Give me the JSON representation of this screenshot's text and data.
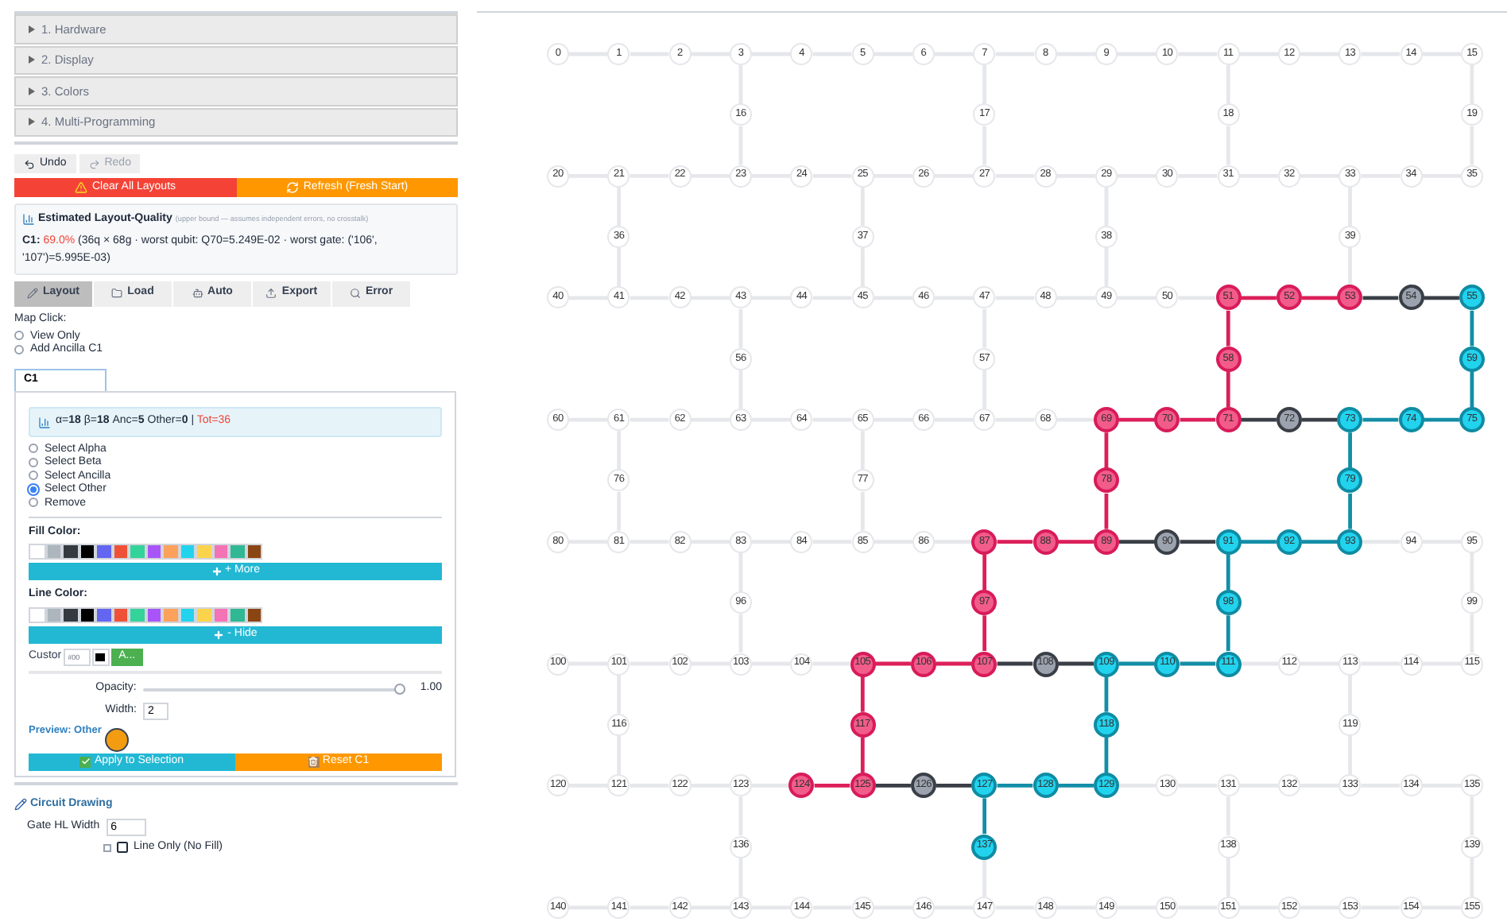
{
  "accordion": [
    {
      "label": "1. Hardware",
      "expanded": false
    },
    {
      "label": "2. Display",
      "expanded": false
    },
    {
      "label": "3. Colors",
      "expanded": false
    },
    {
      "label": "4. Multi-Programming",
      "expanded": false
    }
  ],
  "history_buttons": [
    {
      "label": "Undo",
      "kind": "undo",
      "disabled": false
    },
    {
      "label": "Redo",
      "kind": "redo",
      "disabled": true
    }
  ],
  "actions": [
    {
      "label": "Clear All Layouts",
      "kind": "danger"
    },
    {
      "label": "Refresh (Fresh Start)",
      "kind": "refresh"
    }
  ],
  "quality": {
    "title": "Estimated Layout-Quality",
    "note": "(upper bound — assumes independent errors, no crosstalk)",
    "circuit": "C1:",
    "score": "69.0%",
    "detail": "(36q × 68g · worst qubit: Q70=5.249E-02 · worst gate: ('106', '107')=5.995E-03)"
  },
  "mode_tabs": [
    {
      "label": "Layout",
      "kind": "layout",
      "selected": true
    },
    {
      "label": "Load",
      "kind": "load",
      "selected": false
    },
    {
      "label": "Auto",
      "kind": "auto",
      "selected": false
    },
    {
      "label": "Export",
      "kind": "export",
      "selected": false
    },
    {
      "label": "Error",
      "kind": "error",
      "selected": false
    }
  ],
  "map_click": {
    "label": "Map Click:",
    "options": [
      {
        "label": "View Only",
        "selected": false
      },
      {
        "label": "Add Ancilla C1",
        "selected": false
      }
    ]
  },
  "circuit_tabs": [
    {
      "label": "C1",
      "selected": true
    }
  ],
  "stats": {
    "summary": "α=**18** β=**18** Anc=**5** Other=**0** |",
    "total": "Tot=36"
  },
  "select_modes": [
    {
      "label": "Select Alpha",
      "selected": false
    },
    {
      "label": "Select Beta",
      "selected": false
    },
    {
      "label": "Select Ancilla",
      "selected": false
    },
    {
      "label": "Select Other",
      "selected": true
    },
    {
      "label": "Remove",
      "selected": false
    }
  ],
  "fill_color": {
    "label": "Fill Color:",
    "button": "+ More",
    "swatches": [
      {
        "color": "#ffffff"
      },
      {
        "color": "#adb5bd"
      },
      {
        "color": "#343a40"
      },
      {
        "color": "#000000"
      },
      {
        "color": "#6366f1"
      },
      {
        "color": "#ef5137"
      },
      {
        "color": "#34d399"
      },
      {
        "color": "#a855f7"
      },
      {
        "color": "#fba15b"
      },
      {
        "color": "#22d3ee"
      },
      {
        "color": "#fcd34d"
      },
      {
        "color": "#f472b6"
      },
      {
        "color": "#2fb893"
      },
      {
        "color": "#8b4513"
      }
    ]
  },
  "line_color": {
    "label": "Line Color:",
    "button": "- Hide",
    "swatches": [
      {
        "color": "#ffffff"
      },
      {
        "color": "#adb5bd"
      },
      {
        "color": "#343a40"
      },
      {
        "color": "#000000"
      },
      {
        "color": "#6366f1"
      },
      {
        "color": "#ef5137"
      },
      {
        "color": "#34d399"
      },
      {
        "color": "#a855f7"
      },
      {
        "color": "#fba15b"
      },
      {
        "color": "#22d3ee"
      },
      {
        "color": "#fcd34d"
      },
      {
        "color": "#f472b6"
      },
      {
        "color": "#2fb893"
      },
      {
        "color": "#8b4513"
      }
    ]
  },
  "custom": {
    "label": "Custor",
    "value": "#00",
    "apply": "A..."
  },
  "opacity": {
    "label": "Opacity:",
    "level": 1.0,
    "reading": "1.00"
  },
  "width": {
    "label": "Width:",
    "value": "2"
  },
  "preview": {
    "label": "Preview: Other"
  },
  "apply_buttons": [
    {
      "label": "Apply to Selection",
      "kind": "apply"
    },
    {
      "label": "Reset C1",
      "kind": "reset"
    }
  ],
  "circuit_drawing": {
    "title": "Circuit Drawing",
    "gate_label": "Gate HL Width",
    "gate_value": "6",
    "line_only": {
      "label": "Line Only (No Fill)",
      "checked": false
    }
  },
  "qubits": [
    {
      "label": "0",
      "kind": "idle"
    },
    {
      "label": "1",
      "kind": "idle"
    },
    {
      "label": "2",
      "kind": "idle"
    },
    {
      "label": "3",
      "kind": "idle"
    },
    {
      "label": "4",
      "kind": "idle"
    },
    {
      "label": "5",
      "kind": "idle"
    },
    {
      "label": "6",
      "kind": "idle"
    },
    {
      "label": "7",
      "kind": "idle"
    },
    {
      "label": "8",
      "kind": "idle"
    },
    {
      "label": "9",
      "kind": "idle"
    },
    {
      "label": "10",
      "kind": "idle"
    },
    {
      "label": "11",
      "kind": "idle"
    },
    {
      "label": "12",
      "kind": "idle"
    },
    {
      "label": "13",
      "kind": "idle"
    },
    {
      "label": "14",
      "kind": "idle"
    },
    {
      "label": "15",
      "kind": "idle"
    },
    {
      "label": "16",
      "kind": "idle"
    },
    {
      "label": "17",
      "kind": "idle"
    },
    {
      "label": "18",
      "kind": "idle"
    },
    {
      "label": "19",
      "kind": "idle"
    },
    {
      "label": "20",
      "kind": "idle"
    },
    {
      "label": "21",
      "kind": "idle"
    },
    {
      "label": "22",
      "kind": "idle"
    },
    {
      "label": "23",
      "kind": "idle"
    },
    {
      "label": "24",
      "kind": "idle"
    },
    {
      "label": "25",
      "kind": "idle"
    },
    {
      "label": "26",
      "kind": "idle"
    },
    {
      "label": "27",
      "kind": "idle"
    },
    {
      "label": "28",
      "kind": "idle"
    },
    {
      "label": "29",
      "kind": "idle"
    },
    {
      "label": "30",
      "kind": "idle"
    },
    {
      "label": "31",
      "kind": "idle"
    },
    {
      "label": "32",
      "kind": "idle"
    },
    {
      "label": "33",
      "kind": "idle"
    },
    {
      "label": "34",
      "kind": "idle"
    },
    {
      "label": "35",
      "kind": "idle"
    },
    {
      "label": "36",
      "kind": "idle"
    },
    {
      "label": "37",
      "kind": "idle"
    },
    {
      "label": "38",
      "kind": "idle"
    },
    {
      "label": "39",
      "kind": "idle"
    },
    {
      "label": "40",
      "kind": "idle"
    },
    {
      "label": "41",
      "kind": "idle"
    },
    {
      "label": "42",
      "kind": "idle"
    },
    {
      "label": "43",
      "kind": "idle"
    },
    {
      "label": "44",
      "kind": "idle"
    },
    {
      "label": "45",
      "kind": "idle"
    },
    {
      "label": "46",
      "kind": "idle"
    },
    {
      "label": "47",
      "kind": "idle"
    },
    {
      "label": "48",
      "kind": "idle"
    },
    {
      "label": "49",
      "kind": "idle"
    },
    {
      "label": "50",
      "kind": "idle"
    },
    {
      "label": "51",
      "kind": "alpha"
    },
    {
      "label": "52",
      "kind": "alpha"
    },
    {
      "label": "53",
      "kind": "alpha"
    },
    {
      "label": "54",
      "kind": "ancilla"
    },
    {
      "label": "55",
      "kind": "beta"
    },
    {
      "label": "56",
      "kind": "idle"
    },
    {
      "label": "57",
      "kind": "idle"
    },
    {
      "label": "58",
      "kind": "alpha"
    },
    {
      "label": "59",
      "kind": "beta"
    },
    {
      "label": "60",
      "kind": "idle"
    },
    {
      "label": "61",
      "kind": "idle"
    },
    {
      "label": "62",
      "kind": "idle"
    },
    {
      "label": "63",
      "kind": "idle"
    },
    {
      "label": "64",
      "kind": "idle"
    },
    {
      "label": "65",
      "kind": "idle"
    },
    {
      "label": "66",
      "kind": "idle"
    },
    {
      "label": "67",
      "kind": "idle"
    },
    {
      "label": "68",
      "kind": "idle"
    },
    {
      "label": "69",
      "kind": "alpha"
    },
    {
      "label": "70",
      "kind": "alpha"
    },
    {
      "label": "71",
      "kind": "alpha"
    },
    {
      "label": "72",
      "kind": "ancilla"
    },
    {
      "label": "73",
      "kind": "beta"
    },
    {
      "label": "74",
      "kind": "beta"
    },
    {
      "label": "75",
      "kind": "beta"
    },
    {
      "label": "76",
      "kind": "idle"
    },
    {
      "label": "77",
      "kind": "idle"
    },
    {
      "label": "78",
      "kind": "alpha"
    },
    {
      "label": "79",
      "kind": "beta"
    },
    {
      "label": "80",
      "kind": "idle"
    },
    {
      "label": "81",
      "kind": "idle"
    },
    {
      "label": "82",
      "kind": "idle"
    },
    {
      "label": "83",
      "kind": "idle"
    },
    {
      "label": "84",
      "kind": "idle"
    },
    {
      "label": "85",
      "kind": "idle"
    },
    {
      "label": "86",
      "kind": "idle"
    },
    {
      "label": "87",
      "kind": "alpha"
    },
    {
      "label": "88",
      "kind": "alpha"
    },
    {
      "label": "89",
      "kind": "alpha"
    },
    {
      "label": "90",
      "kind": "ancilla"
    },
    {
      "label": "91",
      "kind": "beta"
    },
    {
      "label": "92",
      "kind": "beta"
    },
    {
      "label": "93",
      "kind": "beta"
    },
    {
      "label": "94",
      "kind": "idle"
    },
    {
      "label": "95",
      "kind": "idle"
    },
    {
      "label": "96",
      "kind": "idle"
    },
    {
      "label": "97",
      "kind": "alpha"
    },
    {
      "label": "98",
      "kind": "beta"
    },
    {
      "label": "99",
      "kind": "idle"
    },
    {
      "label": "100",
      "kind": "idle"
    },
    {
      "label": "101",
      "kind": "idle"
    },
    {
      "label": "102",
      "kind": "idle"
    },
    {
      "label": "103",
      "kind": "idle"
    },
    {
      "label": "104",
      "kind": "idle"
    },
    {
      "label": "105",
      "kind": "alpha"
    },
    {
      "label": "106",
      "kind": "alpha"
    },
    {
      "label": "107",
      "kind": "alpha"
    },
    {
      "label": "108",
      "kind": "ancilla"
    },
    {
      "label": "109",
      "kind": "beta"
    },
    {
      "label": "110",
      "kind": "beta"
    },
    {
      "label": "111",
      "kind": "beta"
    },
    {
      "label": "112",
      "kind": "idle"
    },
    {
      "label": "113",
      "kind": "idle"
    },
    {
      "label": "114",
      "kind": "idle"
    },
    {
      "label": "115",
      "kind": "idle"
    },
    {
      "label": "116",
      "kind": "idle"
    },
    {
      "label": "117",
      "kind": "alpha"
    },
    {
      "label": "118",
      "kind": "beta"
    },
    {
      "label": "119",
      "kind": "idle"
    },
    {
      "label": "120",
      "kind": "idle"
    },
    {
      "label": "121",
      "kind": "idle"
    },
    {
      "label": "122",
      "kind": "idle"
    },
    {
      "label": "123",
      "kind": "idle"
    },
    {
      "label": "124",
      "kind": "alpha"
    },
    {
      "label": "125",
      "kind": "alpha"
    },
    {
      "label": "126",
      "kind": "ancilla"
    },
    {
      "label": "127",
      "kind": "beta"
    },
    {
      "label": "128",
      "kind": "beta"
    },
    {
      "label": "129",
      "kind": "beta"
    },
    {
      "label": "130",
      "kind": "idle"
    },
    {
      "label": "131",
      "kind": "idle"
    },
    {
      "label": "132",
      "kind": "idle"
    },
    {
      "label": "133",
      "kind": "idle"
    },
    {
      "label": "134",
      "kind": "idle"
    },
    {
      "label": "135",
      "kind": "idle"
    },
    {
      "label": "136",
      "kind": "idle"
    },
    {
      "label": "137",
      "kind": "beta"
    },
    {
      "label": "138",
      "kind": "idle"
    },
    {
      "label": "139",
      "kind": "idle"
    },
    {
      "label": "140",
      "kind": "idle"
    },
    {
      "label": "141",
      "kind": "idle"
    },
    {
      "label": "142",
      "kind": "idle"
    },
    {
      "label": "143",
      "kind": "idle"
    },
    {
      "label": "144",
      "kind": "idle"
    },
    {
      "label": "145",
      "kind": "idle"
    },
    {
      "label": "146",
      "kind": "idle"
    },
    {
      "label": "147",
      "kind": "idle"
    },
    {
      "label": "148",
      "kind": "idle"
    },
    {
      "label": "149",
      "kind": "idle"
    },
    {
      "label": "150",
      "kind": "idle"
    },
    {
      "label": "151",
      "kind": "idle"
    },
    {
      "label": "152",
      "kind": "idle"
    },
    {
      "label": "153",
      "kind": "idle"
    },
    {
      "label": "154",
      "kind": "idle"
    },
    {
      "label": "155",
      "kind": "idle"
    }
  ]
}
